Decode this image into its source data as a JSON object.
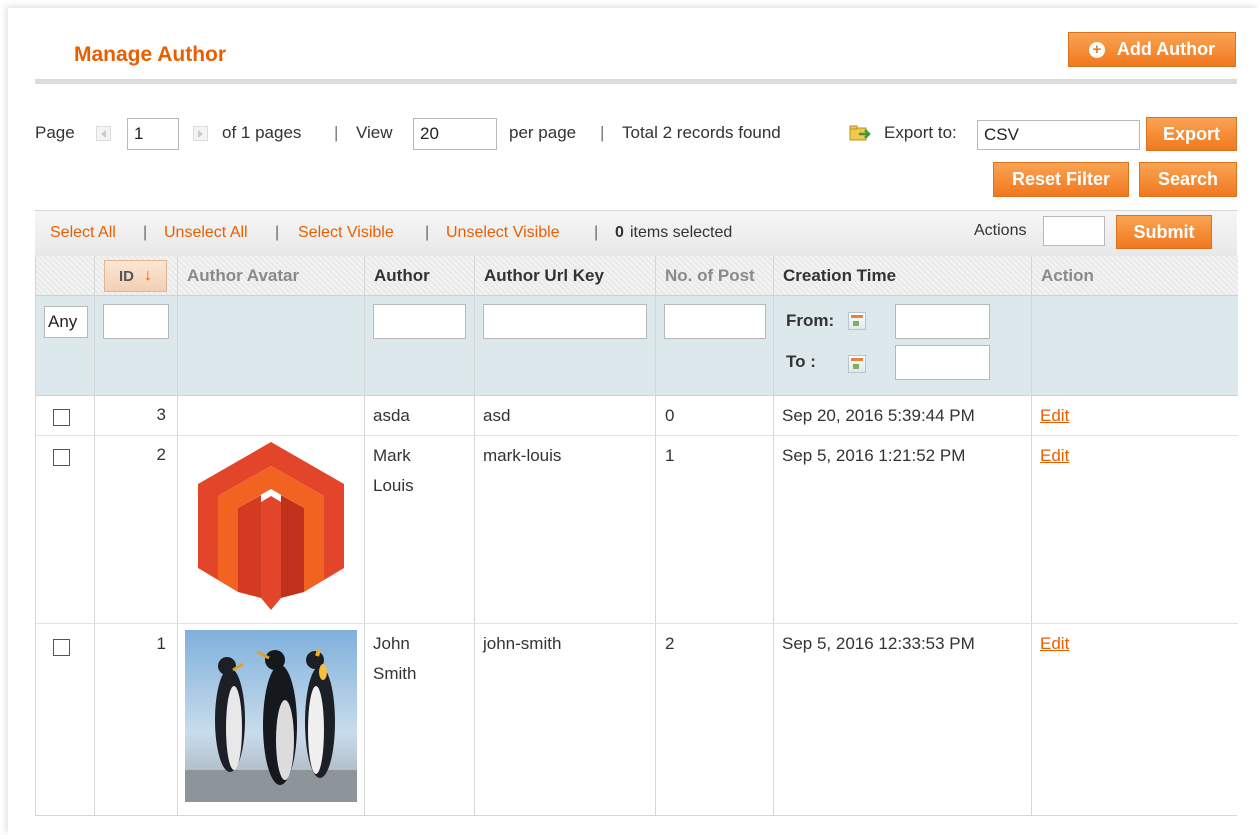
{
  "header": {
    "title": "Manage Author",
    "add_button": "Add Author"
  },
  "pager": {
    "page_label": "Page",
    "page_value": "1",
    "of_pages": "of 1 pages",
    "view_label": "View",
    "per_page_value": "20",
    "per_page_label": "per page",
    "total_text": "Total 2 records found",
    "export_label": "Export to:",
    "export_format": "CSV",
    "export_button": "Export",
    "reset_button": "Reset Filter",
    "search_button": "Search"
  },
  "massaction": {
    "select_all": "Select All",
    "unselect_all": "Unselect All",
    "select_visible": "Select Visible",
    "unselect_visible": "Unselect Visible",
    "selected_count": "0",
    "selected_text": "items selected",
    "actions_label": "Actions",
    "submit_button": "Submit"
  },
  "grid": {
    "columns": {
      "id": "ID",
      "avatar": "Author Avatar",
      "author": "Author",
      "url_key": "Author Url Key",
      "posts": "No. of Post",
      "created": "Creation Time",
      "action": "Action"
    },
    "filter": {
      "any_value": "Any",
      "from_label": "From:",
      "to_label": "To :"
    },
    "rows": [
      {
        "id": "3",
        "author_line1": "asda",
        "author_line2": "",
        "url_key": "asd",
        "posts": "0",
        "created": "Sep 20, 2016 5:39:44 PM",
        "action": "Edit",
        "avatar": ""
      },
      {
        "id": "2",
        "author_line1": "Mark",
        "author_line2": "Louis",
        "url_key": "mark-louis",
        "posts": "1",
        "created": "Sep 5, 2016 1:21:52 PM",
        "action": "Edit",
        "avatar": "magento-logo"
      },
      {
        "id": "1",
        "author_line1": "John",
        "author_line2": "Smith",
        "url_key": "john-smith",
        "posts": "2",
        "created": "Sep 5, 2016 12:33:53 PM",
        "action": "Edit",
        "avatar": "penguins-photo"
      }
    ]
  },
  "colors": {
    "accent": "#eb5e00",
    "button": "#f1781e",
    "filter_bg": "#dde8ec",
    "magento_red": "#e3452b"
  }
}
